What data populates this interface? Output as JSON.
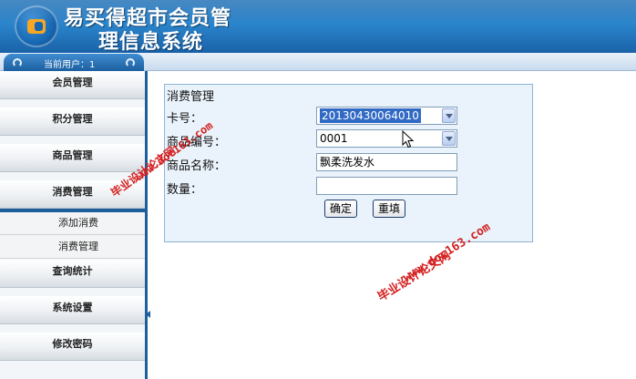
{
  "header": {
    "title_line1": "易买得超市会员管",
    "title_line2": "理信息系统"
  },
  "status": {
    "current_user": "当前用户：1"
  },
  "sidebar": {
    "menus": [
      {
        "label": "会员管理"
      },
      {
        "label": "积分管理"
      },
      {
        "label": "商品管理"
      },
      {
        "label": "消费管理"
      },
      {
        "label": "查询统计"
      },
      {
        "label": "系统设置"
      },
      {
        "label": "修改密码"
      }
    ],
    "submenu": [
      {
        "label": "添加消费"
      },
      {
        "label": "消费管理"
      }
    ]
  },
  "form": {
    "title": "消费管理",
    "card_label": "卡号：",
    "card_value": "20130430064010",
    "product_no_label": "商品编号：",
    "product_no_value": "0001",
    "product_name_label": "商品名称：",
    "product_name_value": "飘柔洗发水",
    "qty_label": "数量：",
    "qty_value": "",
    "confirm_label": "确定",
    "reset_label": "重填"
  },
  "watermark": {
    "text_cn": "毕业设计论文网",
    "text_url": "www.doc163.com"
  },
  "colors": {
    "header_blue": "#2b85cc",
    "sidebar_border": "#1d5f9c",
    "panel_bg": "#eaf3fb",
    "watermark_red": "#d42020",
    "selection_blue": "#316ac5"
  }
}
